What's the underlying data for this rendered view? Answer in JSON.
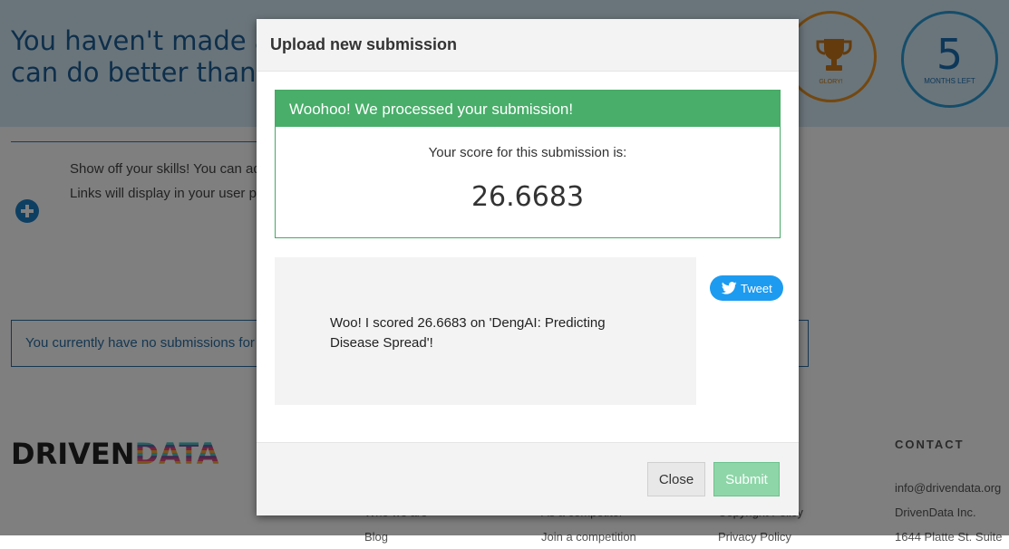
{
  "page": {
    "hero_title_line1": "You haven't made any submissions yet. You",
    "hero_title_line2": "can do better than nothing!",
    "glory_label": "GLORY!",
    "months_number": "5",
    "months_label": "MONTHS LEFT",
    "skills_text": "Show off your skills! You can add links to your write-ups on your blog, on GitHub, BitBucket, GitLab or other sites. Links will display in your user profile if the competition has ended. Good luck winning a prize.",
    "no_submissions_text": "You currently have no submissions for this competition.",
    "logo_driven": "DRIVEN",
    "logo_data": "DATA",
    "footer": {
      "col1": [
        "Who we are",
        "Blog"
      ],
      "col2": [
        "As a competitor",
        "Join a competition"
      ],
      "col3": [
        "Copyright Policy",
        "Privacy Policy"
      ],
      "contact_heading": "CONTACT",
      "contact_lines": [
        "info@drivendata.org",
        "DrivenData Inc.",
        "1644 Platte St. Suite"
      ]
    }
  },
  "modal": {
    "title": "Upload new submission",
    "success_message": "Woohoo! We processed your submission!",
    "score_label": "Your score for this submission is:",
    "score_value": "26.6683",
    "tweet_text": "Woo! I scored 26.6683 on 'DengAI: Predicting Disease Spread'!",
    "tweet_button_label": "Tweet",
    "close_label": "Close",
    "submit_label": "Submit"
  },
  "colors": {
    "success_green": "#48ae6a",
    "submit_green": "#8ed6a8",
    "twitter_blue": "#1d9bf0",
    "glory_orange": "#e69023",
    "months_blue": "#2a9ad5"
  },
  "icons": [
    "trophy-icon",
    "plus-circle-icon",
    "twitter-bird-icon"
  ]
}
